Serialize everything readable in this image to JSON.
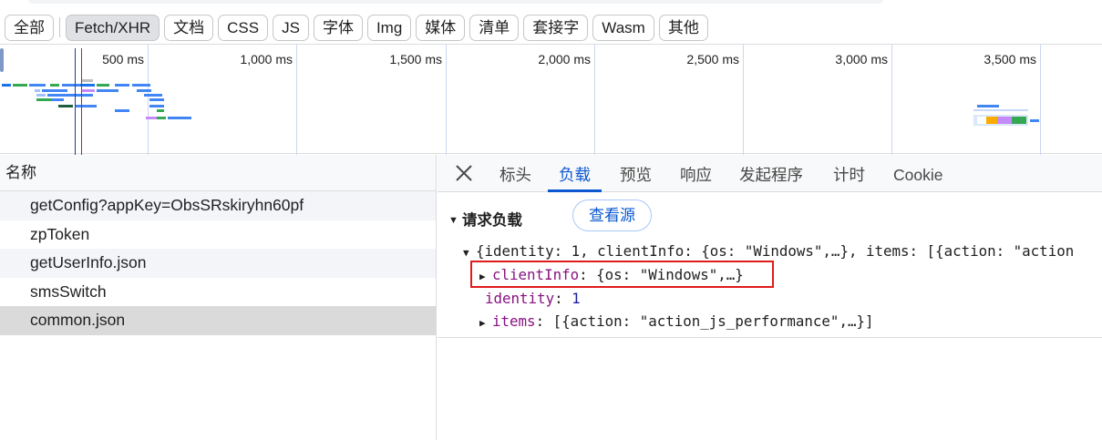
{
  "filters": {
    "items": [
      "全部",
      "Fetch/XHR",
      "文档",
      "CSS",
      "JS",
      "字体",
      "Img",
      "媒体",
      "清单",
      "套接字",
      "Wasm",
      "其他"
    ],
    "active": "Fetch/XHR"
  },
  "timeline": {
    "tick_labels": [
      "500 ms",
      "1,000 ms",
      "1,500 ms",
      "2,000 ms",
      "2,500 ms",
      "3,000 ms",
      "3,500 ms"
    ]
  },
  "requests": {
    "header": "名称",
    "rows": [
      "getConfig?appKey=ObsSRskiryhn60pf",
      "zpToken",
      "getUserInfo.json",
      "smsSwitch",
      "common.json"
    ],
    "selected_index": 4
  },
  "detail": {
    "tabs": [
      "标头",
      "负载",
      "预览",
      "响应",
      "发起程序",
      "计时",
      "Cookie"
    ],
    "active_tab": "负载",
    "section_title": "请求负载",
    "view_source_label": "查看源",
    "payload": {
      "root_summary": "{identity: 1, clientInfo: {os: \"Windows\",…}, items: [{action: \"action",
      "client_info_key": "clientInfo",
      "client_info_value": "{os: \"Windows\",…}",
      "identity_key": "identity",
      "identity_value": "1",
      "items_key": "items",
      "items_value": "[{action: \"action_js_performance\",…}]"
    }
  },
  "colors": {
    "accent": "#0b57d0",
    "highlight_box": "#e01b1b",
    "selected_row": "#dadada"
  }
}
